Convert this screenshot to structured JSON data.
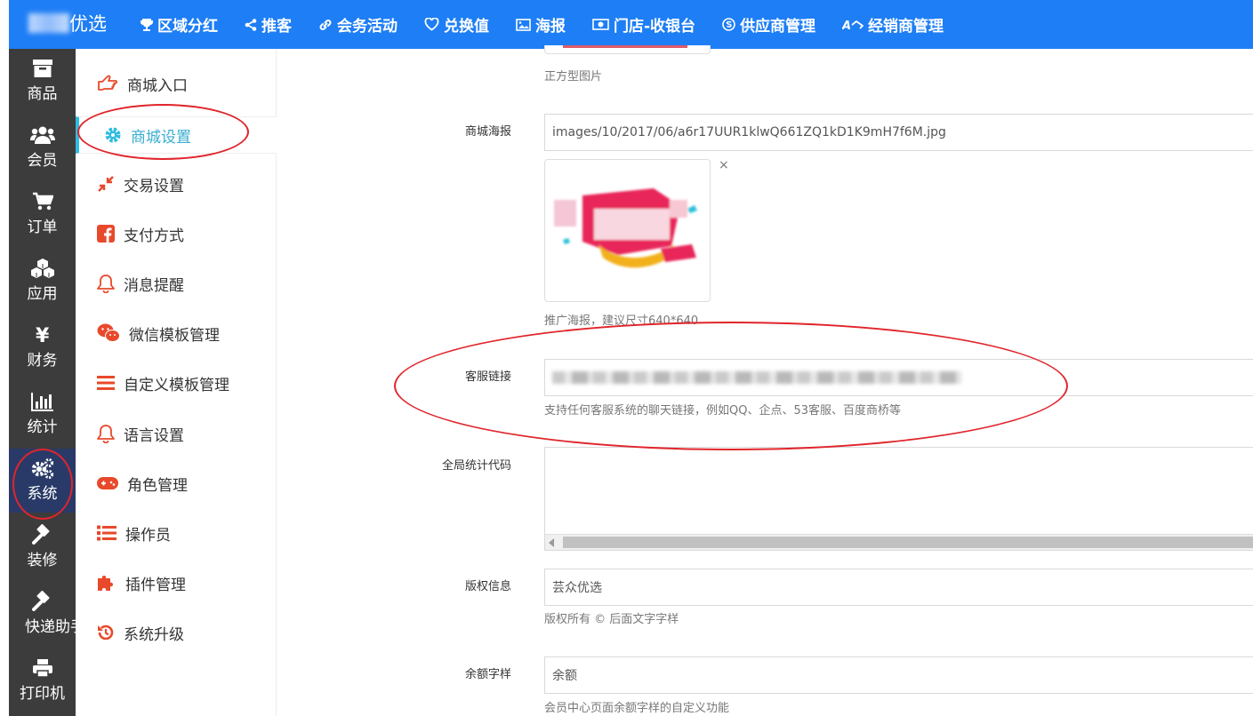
{
  "topbar": {
    "brand_text": "优选",
    "nav": [
      {
        "label": "区域分红",
        "icon": "trophy-icon"
      },
      {
        "label": "推客",
        "icon": "share-icon"
      },
      {
        "label": "会务活动",
        "icon": "link-icon"
      },
      {
        "label": "兑换值",
        "icon": "heart-icon"
      },
      {
        "label": "海报",
        "icon": "image-icon"
      },
      {
        "label": "门店-收银台",
        "icon": "money-icon"
      },
      {
        "label": "供应商管理",
        "icon": "skype-icon"
      },
      {
        "label": "经销商管理",
        "icon": "vendor-icon"
      }
    ],
    "color": "#1e7ef5"
  },
  "leftbar": {
    "items": [
      {
        "label": "商品",
        "icon": "archive-icon"
      },
      {
        "label": "会员",
        "icon": "users-icon"
      },
      {
        "label": "订单",
        "icon": "cart-icon"
      },
      {
        "label": "应用",
        "icon": "cubes-icon"
      },
      {
        "label": "财务",
        "icon": "yen-icon"
      },
      {
        "label": "统计",
        "icon": "bar-chart-icon"
      },
      {
        "label": "系统",
        "icon": "gears-icon"
      },
      {
        "label": "装修",
        "icon": "gavel-icon"
      },
      {
        "label": "快递助手",
        "icon": "gavel-icon"
      },
      {
        "label": "打印机",
        "icon": "print-icon"
      }
    ],
    "active_index": 6
  },
  "submenu": {
    "items": [
      {
        "label": "商城入口",
        "icon": "hand-pointer-icon"
      },
      {
        "label": "商城设置",
        "icon": "gear-icon"
      },
      {
        "label": "交易设置",
        "icon": "compress-icon"
      },
      {
        "label": "支付方式",
        "icon": "facebook-icon"
      },
      {
        "label": "消息提醒",
        "icon": "bell-icon"
      },
      {
        "label": "微信模板管理",
        "icon": "wechat-icon"
      },
      {
        "label": "自定义模板管理",
        "icon": "bars-icon"
      },
      {
        "label": "语言设置",
        "icon": "bell-icon"
      },
      {
        "label": "角色管理",
        "icon": "gamepad-icon"
      },
      {
        "label": "操作员",
        "icon": "list-icon"
      },
      {
        "label": "插件管理",
        "icon": "puzzle-icon"
      },
      {
        "label": "系统升级",
        "icon": "history-icon"
      }
    ],
    "active_index": 1,
    "icon_color": "#e8492b",
    "active_color": "#2fbce0"
  },
  "form": {
    "square_help": "正方型图片",
    "poster": {
      "label": "商城海报",
      "value": "images/10/2017/06/a6r17UUR1klwQ661ZQ1kD1K9mH7f6M.jpg",
      "remove": "×",
      "help": "推广海报，建议尺寸640*640"
    },
    "service": {
      "label": "客服链接",
      "help": "支持任何客服系统的聊天链接，例如QQ、企点、53客服、百度商桥等"
    },
    "stats": {
      "label": "全局统计代码"
    },
    "copyright": {
      "label": "版权信息",
      "value": "芸众优选",
      "help": "版权所有 © 后面文字字样"
    },
    "balance": {
      "label": "余额字样",
      "value": "余额",
      "help": "会员中心页面余额字样的自定义功能"
    }
  }
}
